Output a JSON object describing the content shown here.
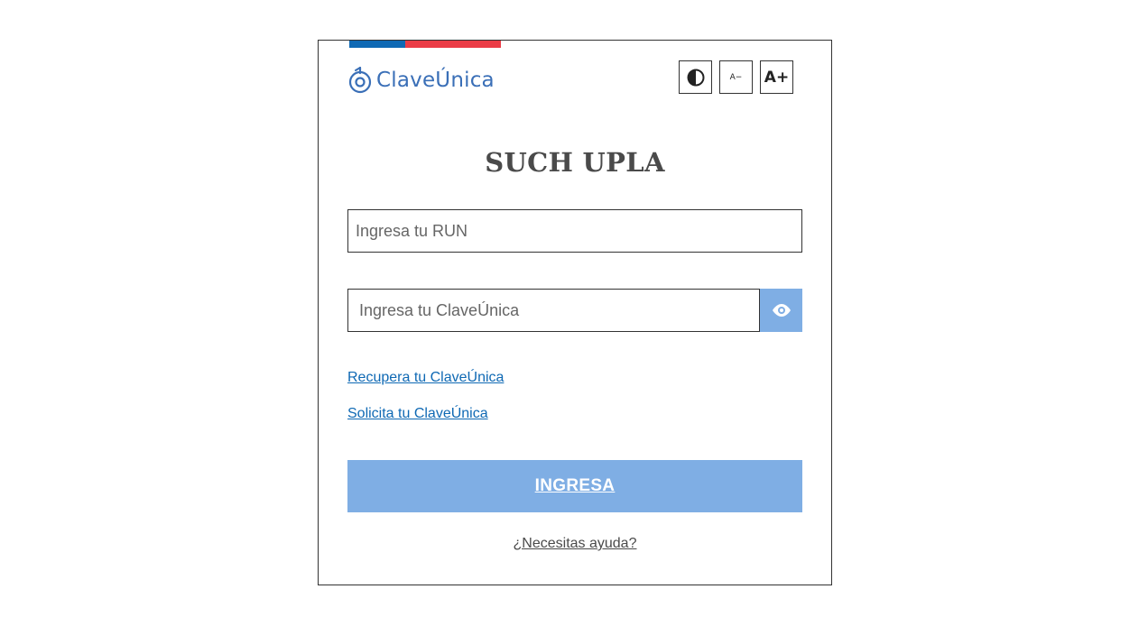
{
  "brand": {
    "logo_text": "ClaveÚnica",
    "flag_colors": [
      "#0f69b4",
      "#eb3c46"
    ],
    "accent_color": "#7faee4",
    "link_color": "#0f69b4"
  },
  "accessibility": {
    "contrast_icon": "contrast-icon",
    "decrease_label": "A−",
    "increase_label": "A+"
  },
  "form": {
    "title": "SUCH UPLA",
    "run_placeholder": "Ingresa tu RUN",
    "password_placeholder": "Ingresa tu ClaveÚnica",
    "show_password_icon": "eye-icon",
    "recover_link": "Recupera tu ClaveÚnica",
    "request_link": "Solicita tu ClaveÚnica",
    "submit_label": "INGRESA",
    "help_link": "¿Necesitas ayuda?"
  }
}
